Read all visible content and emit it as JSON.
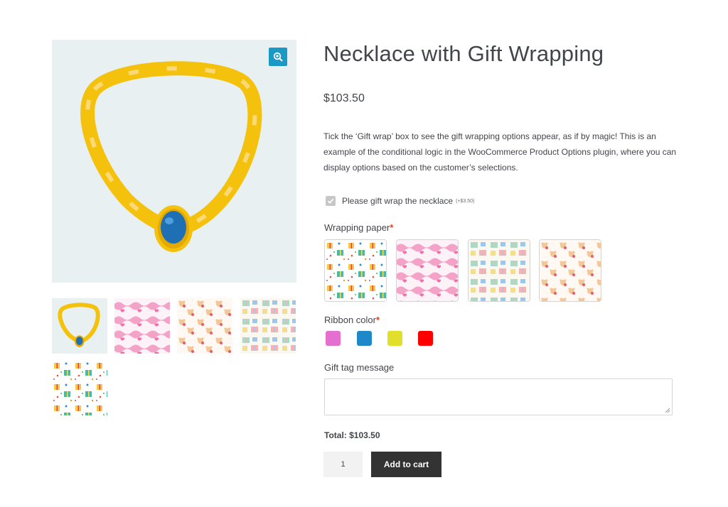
{
  "product": {
    "title": "Necklace with Gift Wrapping",
    "price": "$103.50",
    "description": "Tick the ‘Gift wrap’ box to see the gift wrapping options appear, as if by magic! This is an example of the conditional logic in the WooCommerce Product Options plugin, where you can display options based on the customer’s selections."
  },
  "gallery": {
    "zoom_icon": "magnify-plus-icon",
    "thumbnails": [
      "necklace",
      "pink-hearts-waves",
      "teddy-bears",
      "pastel-gifts",
      "colorful-presents"
    ]
  },
  "gift_wrap": {
    "label": "Please gift wrap the necklace",
    "fee": "(+$3.50)",
    "checked": true
  },
  "wrapping_paper": {
    "label": "Wrapping paper",
    "required_mark": "*",
    "options": [
      "colorful-presents",
      "pink-hearts-waves",
      "pastel-gifts",
      "teddy-bears"
    ]
  },
  "ribbon_color": {
    "label": "Ribbon color",
    "required_mark": "*",
    "colors": [
      "#e46fcf",
      "#1e88c9",
      "#e2df2a",
      "#ff0000"
    ]
  },
  "gift_tag": {
    "label": "Gift tag message",
    "value": ""
  },
  "total": {
    "label": "Total:",
    "value": "$103.50"
  },
  "cart": {
    "quantity": "1",
    "button_label": "Add to cart"
  },
  "colors": {
    "accent": "#1a99c4",
    "button_bg": "#333333",
    "required": "#e2401c",
    "gallery_bg": "#e8f0f2"
  }
}
